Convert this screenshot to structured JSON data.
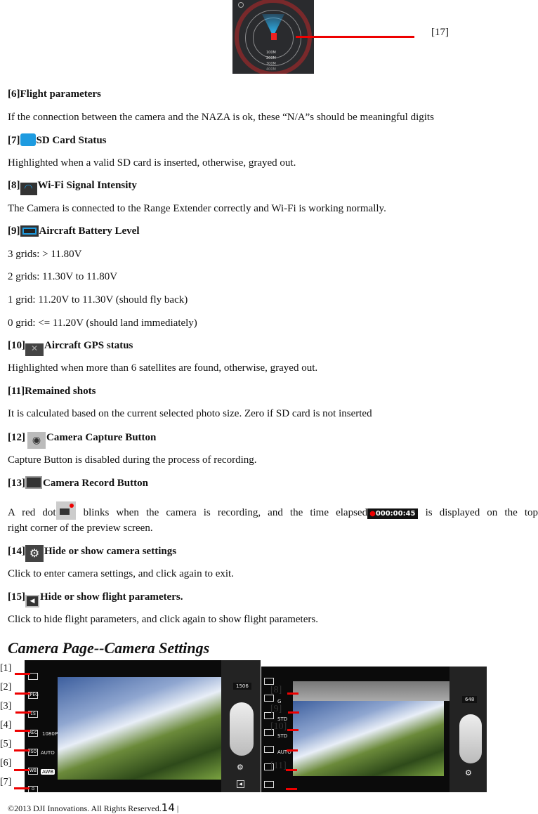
{
  "top_figure": {
    "label": "[17]",
    "radar_rings": [
      "100M",
      "200M",
      "300M",
      "400M"
    ]
  },
  "sections": [
    {
      "title": "[6]Flight parameters",
      "body": [
        "If the connection between the camera and the NAZA is ok, these “N/A”s should be meaningful digits"
      ]
    },
    {
      "num": "[7]",
      "icon": "sd-card-icon",
      "title": "SD Card Status",
      "body": [
        "Highlighted when a valid SD card is inserted, otherwise, grayed out."
      ]
    },
    {
      "num": "[8]",
      "icon": "wifi-icon",
      "title": "Wi-Fi Signal Intensity",
      "body": [
        "The Camera is connected to the Range Extender correctly and Wi-Fi is working normally."
      ]
    },
    {
      "num": "[9]",
      "icon": "battery-icon",
      "title": "Aircraft Battery Level",
      "body": [
        "3 grids: > 11.80V",
        "2 grids: 11.30V to 11.80V",
        "1 grid: 11.20V to 11.30V (should fly back)",
        "0 grid: <= 11.20V (should land immediately)"
      ]
    },
    {
      "num": "[10]",
      "icon": "satellite-icon",
      "title": "Aircraft GPS status",
      "body": [
        "Highlighted when more than 6 satellites are found, otherwise, grayed out."
      ]
    },
    {
      "title": "[11]Remained shots",
      "body": [
        "It is calculated based on the current selected photo size. Zero if SD card is not inserted"
      ]
    },
    {
      "num": "[12]",
      "icon": "camera-icon",
      "title": "Camera Capture Button",
      "body": [
        "Capture Button is disabled during the process of recording."
      ]
    },
    {
      "num": "[13]",
      "icon": "video-camera-icon",
      "title": "Camera Record Button",
      "body_a": "A red dot",
      "body_b": " blinks when the camera is recording, and the time elapsed",
      "timer": "000:00:45",
      "body_c": " is displayed on the top",
      "body_d": "right corner of the preview screen."
    },
    {
      "num": "[14]",
      "icon": "gear-icon",
      "title": "Hide or show camera settings",
      "body": [
        "Click to enter camera settings, and click again to exit."
      ]
    },
    {
      "num": "[15]",
      "icon": "collapse-arrow-icon",
      "title": "Hide or show flight parameters.",
      "body": [
        "Click to hide flight parameters, and click again to show flight parameters."
      ]
    }
  ],
  "camera_settings": {
    "heading": "Camera Page--Camera Settings",
    "left_labels": [
      "[1]",
      "[2]",
      "[3]",
      "[4]",
      "[5]",
      "[6]",
      "[7]"
    ],
    "left_buttons": [
      "",
      "JPEG",
      "1S",
      "REC",
      "ISO",
      "WB",
      "⊙"
    ],
    "left_values": {
      "resolution": "1080P",
      "iso": "AUTO",
      "wb": "AWB"
    },
    "left_shots": "1506",
    "right_labels": [
      "[8]",
      "[9]",
      "[10]",
      "[11]"
    ],
    "right_values": [
      "G",
      "STD",
      "STD",
      "AUTO"
    ],
    "right_shots": "648"
  },
  "footer": {
    "copyright": "©2013 DJI Innovations. All Rights Reserved.",
    "page": "14",
    "sep": "|"
  },
  "colors": {
    "accent_blue": "#1e9be0",
    "pointer_red": "#e00000"
  }
}
